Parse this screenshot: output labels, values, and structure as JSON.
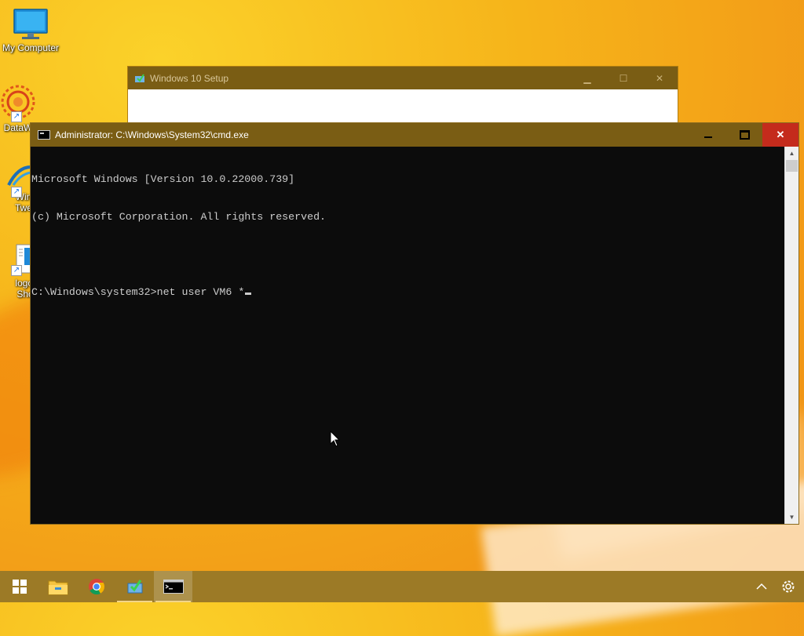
{
  "desktop": {
    "icons": [
      {
        "label": "My Computer"
      },
      {
        "label": "DataW"
      },
      {
        "label": "Win Twe"
      },
      {
        "label": "logoff Shor"
      }
    ]
  },
  "setup_window": {
    "title": "Windows 10 Setup"
  },
  "cmd_window": {
    "title": "Administrator: C:\\Windows\\System32\\cmd.exe",
    "lines": [
      "Microsoft Windows [Version 10.0.22000.739]",
      "(c) Microsoft Corporation. All rights reserved.",
      "",
      "C:\\Windows\\system32>net user VM6 *"
    ]
  },
  "taskbar": {
    "buttons": [
      "start",
      "file-explorer",
      "chrome",
      "windows-10-setup",
      "command-prompt"
    ],
    "active": "command-prompt"
  },
  "colors": {
    "titlebar": "#7a5d14",
    "taskbar": "#9c7a26",
    "close_button": "#c42b1c",
    "console_bg": "#0c0c0c",
    "console_text": "#cccccc"
  }
}
